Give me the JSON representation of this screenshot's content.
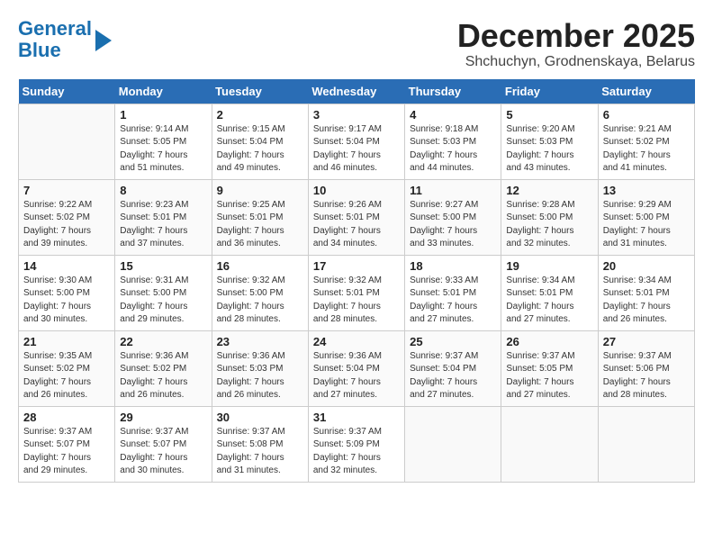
{
  "header": {
    "logo_line1": "General",
    "logo_line2": "Blue",
    "month_title": "December 2025",
    "location": "Shchuchyn, Grodnenskaya, Belarus"
  },
  "weekdays": [
    "Sunday",
    "Monday",
    "Tuesday",
    "Wednesday",
    "Thursday",
    "Friday",
    "Saturday"
  ],
  "weeks": [
    [
      {
        "day": "",
        "info": ""
      },
      {
        "day": "1",
        "info": "Sunrise: 9:14 AM\nSunset: 5:05 PM\nDaylight: 7 hours\nand 51 minutes."
      },
      {
        "day": "2",
        "info": "Sunrise: 9:15 AM\nSunset: 5:04 PM\nDaylight: 7 hours\nand 49 minutes."
      },
      {
        "day": "3",
        "info": "Sunrise: 9:17 AM\nSunset: 5:04 PM\nDaylight: 7 hours\nand 46 minutes."
      },
      {
        "day": "4",
        "info": "Sunrise: 9:18 AM\nSunset: 5:03 PM\nDaylight: 7 hours\nand 44 minutes."
      },
      {
        "day": "5",
        "info": "Sunrise: 9:20 AM\nSunset: 5:03 PM\nDaylight: 7 hours\nand 43 minutes."
      },
      {
        "day": "6",
        "info": "Sunrise: 9:21 AM\nSunset: 5:02 PM\nDaylight: 7 hours\nand 41 minutes."
      }
    ],
    [
      {
        "day": "7",
        "info": "Sunrise: 9:22 AM\nSunset: 5:02 PM\nDaylight: 7 hours\nand 39 minutes."
      },
      {
        "day": "8",
        "info": "Sunrise: 9:23 AM\nSunset: 5:01 PM\nDaylight: 7 hours\nand 37 minutes."
      },
      {
        "day": "9",
        "info": "Sunrise: 9:25 AM\nSunset: 5:01 PM\nDaylight: 7 hours\nand 36 minutes."
      },
      {
        "day": "10",
        "info": "Sunrise: 9:26 AM\nSunset: 5:01 PM\nDaylight: 7 hours\nand 34 minutes."
      },
      {
        "day": "11",
        "info": "Sunrise: 9:27 AM\nSunset: 5:00 PM\nDaylight: 7 hours\nand 33 minutes."
      },
      {
        "day": "12",
        "info": "Sunrise: 9:28 AM\nSunset: 5:00 PM\nDaylight: 7 hours\nand 32 minutes."
      },
      {
        "day": "13",
        "info": "Sunrise: 9:29 AM\nSunset: 5:00 PM\nDaylight: 7 hours\nand 31 minutes."
      }
    ],
    [
      {
        "day": "14",
        "info": "Sunrise: 9:30 AM\nSunset: 5:00 PM\nDaylight: 7 hours\nand 30 minutes."
      },
      {
        "day": "15",
        "info": "Sunrise: 9:31 AM\nSunset: 5:00 PM\nDaylight: 7 hours\nand 29 minutes."
      },
      {
        "day": "16",
        "info": "Sunrise: 9:32 AM\nSunset: 5:00 PM\nDaylight: 7 hours\nand 28 minutes."
      },
      {
        "day": "17",
        "info": "Sunrise: 9:32 AM\nSunset: 5:01 PM\nDaylight: 7 hours\nand 28 minutes."
      },
      {
        "day": "18",
        "info": "Sunrise: 9:33 AM\nSunset: 5:01 PM\nDaylight: 7 hours\nand 27 minutes."
      },
      {
        "day": "19",
        "info": "Sunrise: 9:34 AM\nSunset: 5:01 PM\nDaylight: 7 hours\nand 27 minutes."
      },
      {
        "day": "20",
        "info": "Sunrise: 9:34 AM\nSunset: 5:01 PM\nDaylight: 7 hours\nand 26 minutes."
      }
    ],
    [
      {
        "day": "21",
        "info": "Sunrise: 9:35 AM\nSunset: 5:02 PM\nDaylight: 7 hours\nand 26 minutes."
      },
      {
        "day": "22",
        "info": "Sunrise: 9:36 AM\nSunset: 5:02 PM\nDaylight: 7 hours\nand 26 minutes."
      },
      {
        "day": "23",
        "info": "Sunrise: 9:36 AM\nSunset: 5:03 PM\nDaylight: 7 hours\nand 26 minutes."
      },
      {
        "day": "24",
        "info": "Sunrise: 9:36 AM\nSunset: 5:04 PM\nDaylight: 7 hours\nand 27 minutes."
      },
      {
        "day": "25",
        "info": "Sunrise: 9:37 AM\nSunset: 5:04 PM\nDaylight: 7 hours\nand 27 minutes."
      },
      {
        "day": "26",
        "info": "Sunrise: 9:37 AM\nSunset: 5:05 PM\nDaylight: 7 hours\nand 27 minutes."
      },
      {
        "day": "27",
        "info": "Sunrise: 9:37 AM\nSunset: 5:06 PM\nDaylight: 7 hours\nand 28 minutes."
      }
    ],
    [
      {
        "day": "28",
        "info": "Sunrise: 9:37 AM\nSunset: 5:07 PM\nDaylight: 7 hours\nand 29 minutes."
      },
      {
        "day": "29",
        "info": "Sunrise: 9:37 AM\nSunset: 5:07 PM\nDaylight: 7 hours\nand 30 minutes."
      },
      {
        "day": "30",
        "info": "Sunrise: 9:37 AM\nSunset: 5:08 PM\nDaylight: 7 hours\nand 31 minutes."
      },
      {
        "day": "31",
        "info": "Sunrise: 9:37 AM\nSunset: 5:09 PM\nDaylight: 7 hours\nand 32 minutes."
      },
      {
        "day": "",
        "info": ""
      },
      {
        "day": "",
        "info": ""
      },
      {
        "day": "",
        "info": ""
      }
    ]
  ]
}
